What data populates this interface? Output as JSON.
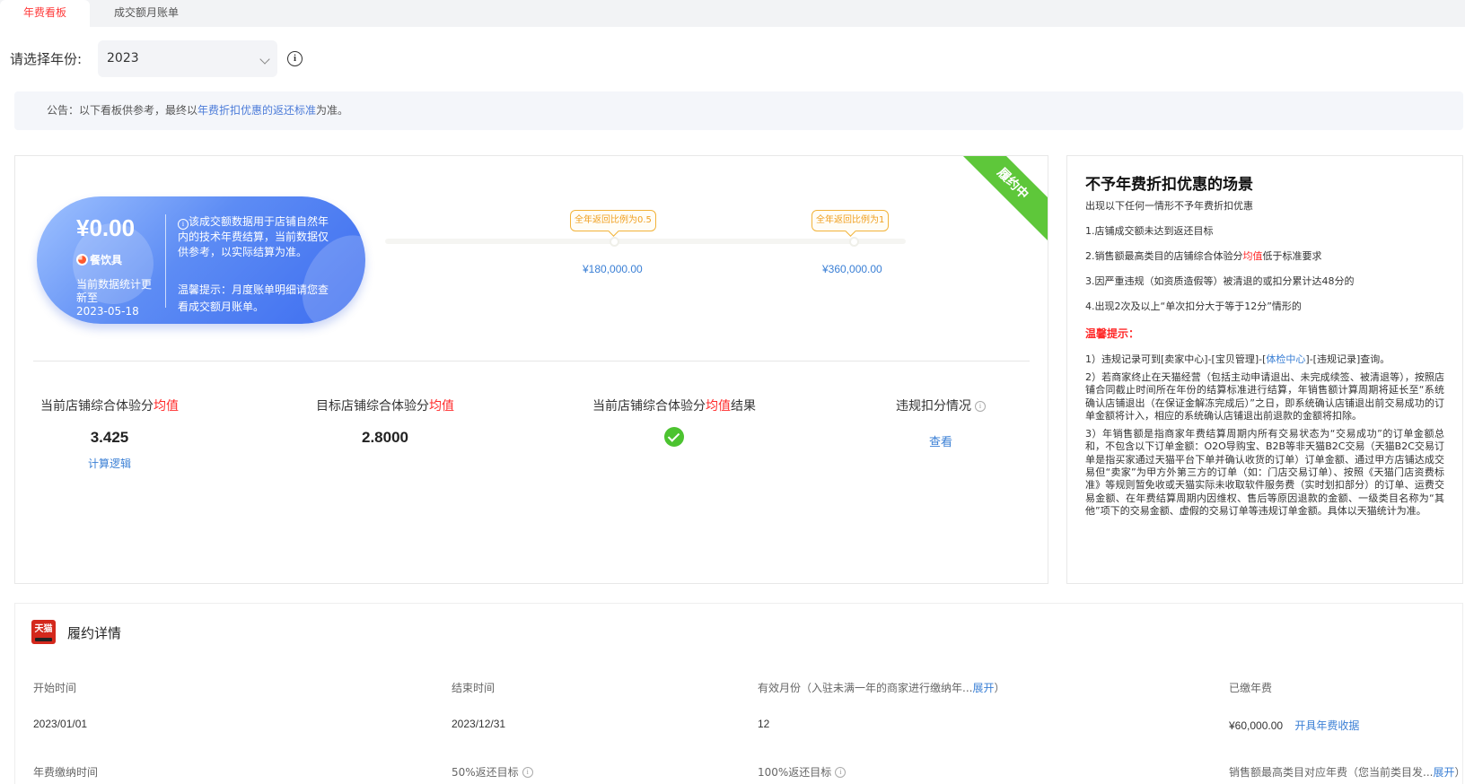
{
  "tabs": [
    {
      "label": "年费看板",
      "active": true
    },
    {
      "label": "成交额月账单",
      "active": false
    }
  ],
  "year_filter": {
    "label": "请选择年份:",
    "selected": "2023"
  },
  "notice": {
    "prefix": "公告：以下看板供参考，最终以",
    "link": "年费折扣优惠的返还标准",
    "suffix": "为准。"
  },
  "status_ribbon": "履约中",
  "sales_card": {
    "amount": "¥0.00",
    "category": "餐饮具",
    "updated_label": "当前数据统计更新至",
    "updated_date": "2023-05-18",
    "description": "该成交额数据用于店铺自然年内的技术年费结算，当前数据仅供参考，以实际结算为准。",
    "tip": "温馨提示：月度账单明细请您查看成交额月账单。"
  },
  "milestones": [
    {
      "label": "全年返回比例为0.5",
      "value": "¥180,000.00",
      "target": 180000
    },
    {
      "label": "全年返回比例为1",
      "value": "¥360,000.00",
      "target": 360000
    }
  ],
  "progress": {
    "current": 0
  },
  "metrics": {
    "current_score": {
      "title_prefix": "当前店铺综合体验分",
      "title_red": "均值",
      "value": "3.425",
      "link": "计算逻辑"
    },
    "target_score": {
      "title_prefix": "目标店铺综合体验分",
      "title_red": "均值",
      "value": "2.8000"
    },
    "score_result": {
      "title_prefix": "当前店铺综合体验分",
      "title_red": "均值",
      "title_suffix": "结果",
      "passed": true
    },
    "violation": {
      "title": "违规扣分情况",
      "link": "查看"
    }
  },
  "rules_panel": {
    "title": "不予年费折扣优惠的场景",
    "intro": "出现以下任何一情形不予年费折扣优惠",
    "items": [
      {
        "text": "1.店铺成交额未达到返还目标"
      },
      {
        "prefix": "2.销售额最高类目的店铺综合体验分",
        "red": "均值",
        "suffix": "低于标准要求"
      },
      {
        "text": "3.因严重违规（如资质造假等）被清退的或扣分累计达48分的"
      },
      {
        "text": "4.出现2次及以上“单次扣分大于等于12分”情形的"
      }
    ],
    "warning_title": "温馨提示：",
    "note1": {
      "prefix": "1）违规记录可到[卖家中心]-[宝贝管理]-[",
      "link": "体检中心",
      "suffix": "]-[违规记录]查询。"
    },
    "note2": "2）若商家终止在天猫经营（包括主动申请退出、未完成续签、被清退等），按照店铺合同截止时间所在年份的结算标准进行结算，年销售额计算周期将延长至“系统确认店铺退出（在保证金解冻完成后）”之日，即系统确认店铺退出前交易成功的订单金额将计入，相应的系统确认店铺退出前退款的金额将扣除。",
    "note3": "3）年销售额是指商家年费结算周期内所有交易状态为“交易成功”的订单金额总和，不包含以下订单金额：O2O导购宝、B2B等非天猫B2C交易（天猫B2C交易订单是指买家通过天猫平台下单并确认收货的订单）订单金额、通过甲方店铺达成交易但“卖家”为甲方外第三方的订单（如：门店交易订单）、按照《天猫门店资费标准》等规则暂免收或天猫实际未收取软件服务费（实时划扣部分）的订单、运费交易金额、在年费结算周期内因维权、售后等原因退款的金额、一级类目名称为“其他”项下的交易金额、虚假的交易订单等违规订单金额。具体以天猫统计为准。"
  },
  "contract": {
    "title": "履约详情",
    "logo_text": "天猫",
    "row1_labels": {
      "start": "开始时间",
      "end": "结束时间",
      "months": "有效月份（入驻未满一年的商家进行缴纳年...",
      "months_expand": "展开",
      "months_close": "）",
      "paid": "已缴年费"
    },
    "row1_values": {
      "start": "2023/01/01",
      "end": "2023/12/31",
      "months": "12",
      "paid": "¥60,000.00",
      "invoice_link": "开具年费收据"
    },
    "row2_labels": {
      "pay_time": "年费缴纳时间",
      "target_50": "50%返还目标",
      "target_100": "100%返还目标",
      "category_fee": "销售额最高类目对应年费（您当前类目发...",
      "category_expand": "展开",
      "category_close": "）"
    }
  }
}
